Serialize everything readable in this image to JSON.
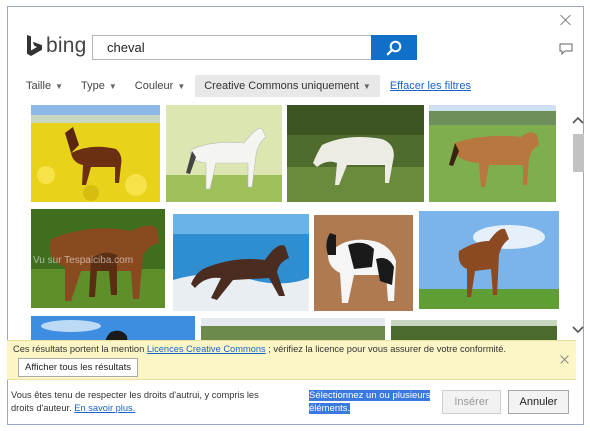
{
  "header": {
    "logo_text": "bing",
    "logo_icon": "bing-logo-icon",
    "close_icon": "close-icon",
    "feedback_icon": "feedback-icon"
  },
  "search": {
    "value": "cheval",
    "button_icon": "search-icon"
  },
  "filters": {
    "items": [
      {
        "label": "Taille",
        "active": false
      },
      {
        "label": "Type",
        "active": false
      },
      {
        "label": "Couleur",
        "active": false
      },
      {
        "label": "Creative Commons uniquement",
        "active": true
      }
    ],
    "clear_label": "Effacer les filtres"
  },
  "results": {
    "watermark": "Vu sur Tespaiciba.com"
  },
  "notice": {
    "text_before": "Ces résultats portent la mention ",
    "link": "Licences Creative Commons",
    "text_after": " ; vérifiez la licence pour vous assurer de votre conformité.",
    "show_all_label": "Afficher tous les résultats"
  },
  "footer": {
    "text": "Vous êtes tenu de respecter les droits d'autrui, y compris les droits d'auteur.",
    "link": "En savoir plus.",
    "selection_hint": "Sélectionnez un ou plusieurs éléments.",
    "insert_label": "Insérer",
    "cancel_label": "Annuler"
  },
  "colors": {
    "accent": "#1070c8",
    "notice_bg": "#fcf6c6",
    "link": "#1a63c8",
    "selection": "#3a7ae0"
  }
}
